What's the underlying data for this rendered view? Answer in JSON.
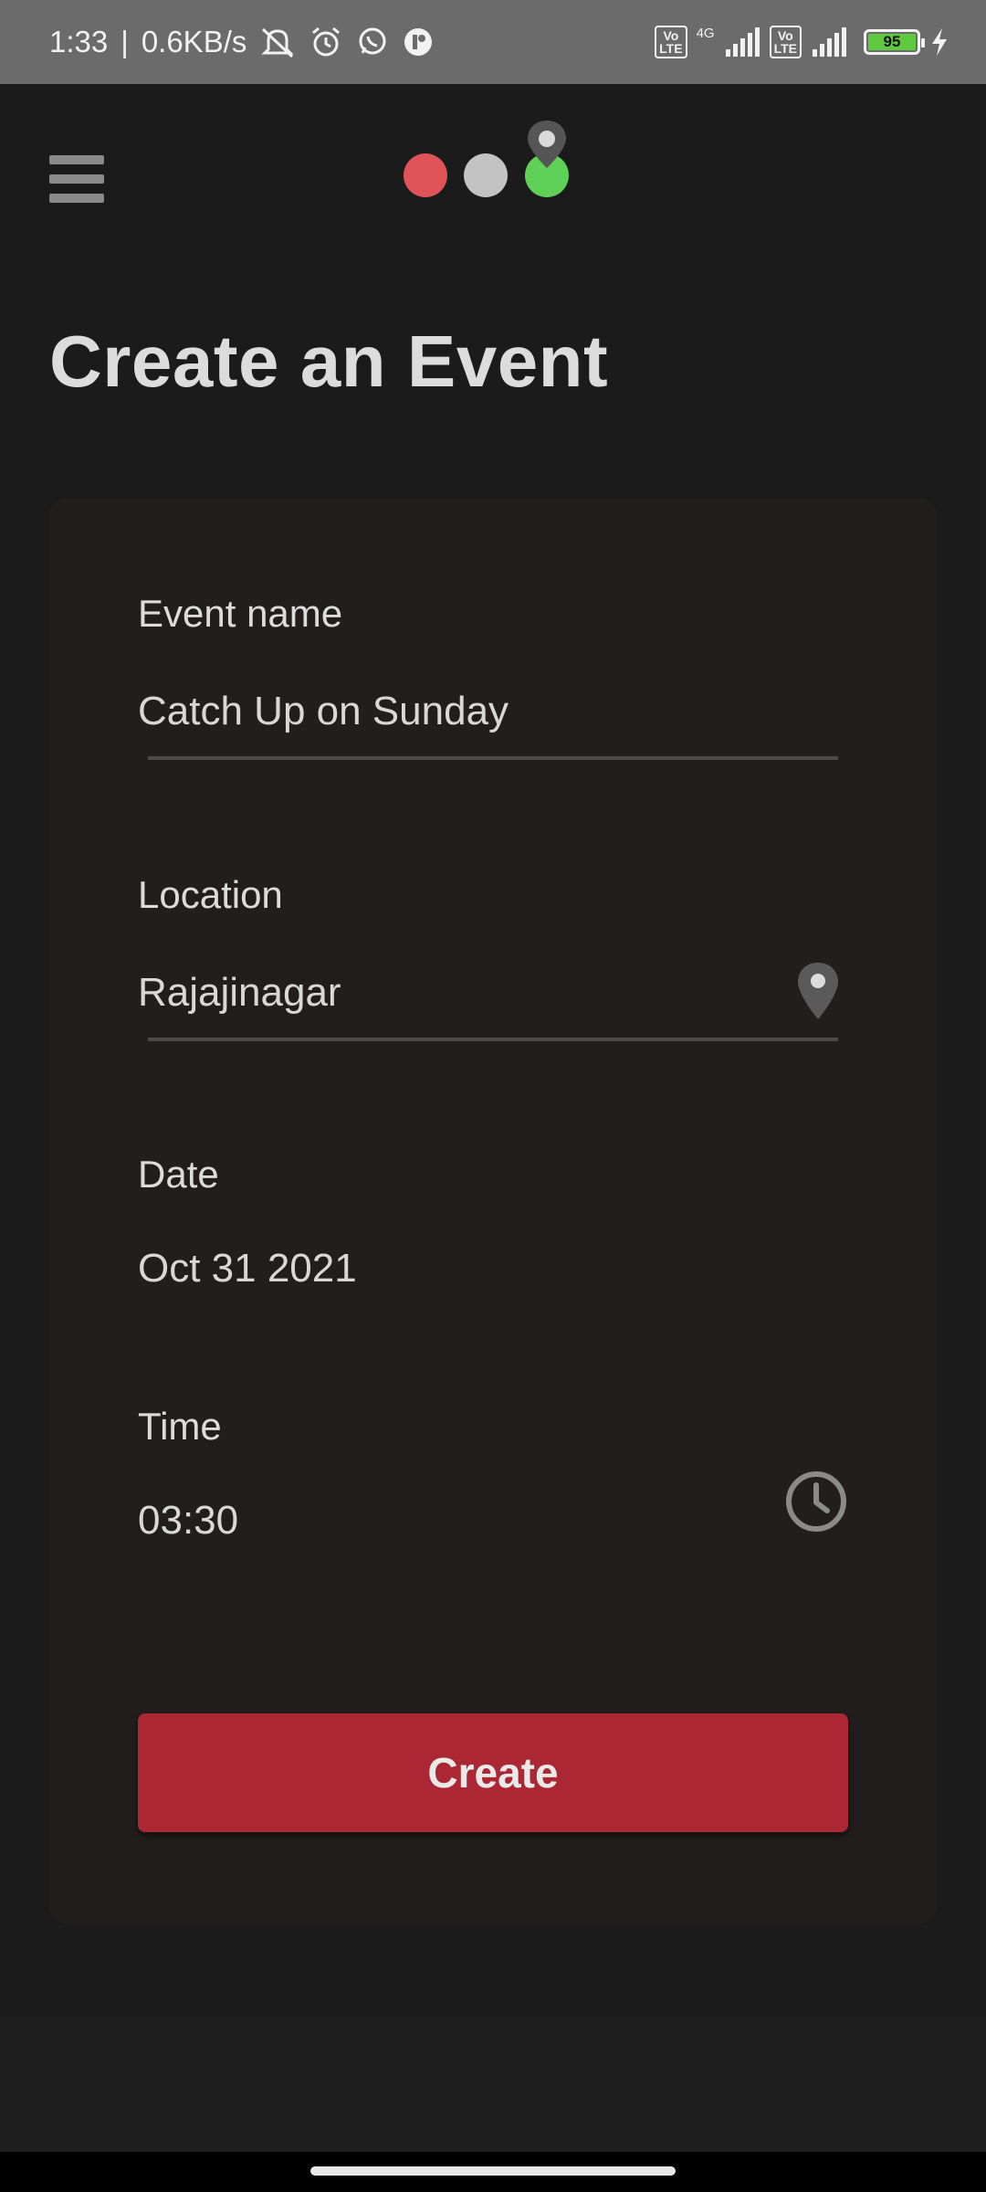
{
  "status_bar": {
    "time": "1:33",
    "speed": "0.6KB/s",
    "network": "4G",
    "volte": "Vo\nLTE",
    "battery": "95",
    "icons": [
      "mute-icon",
      "alarm-icon",
      "whatsapp-icon",
      "app-notification-icon",
      "signal-icon",
      "charging-icon"
    ]
  },
  "app_bar": {
    "menu_icon": "hamburger-menu-icon",
    "logo": {
      "colors": [
        "#e05459",
        "#c3c3c3",
        "#5ed156"
      ],
      "pin_color": "#7a7a7a"
    }
  },
  "page": {
    "title": "Create an Event"
  },
  "form": {
    "event_name": {
      "label": "Event name",
      "value": "Catch Up on Sunday"
    },
    "location": {
      "label": "Location",
      "value": "Rajajinagar",
      "icon": "location-pin-icon"
    },
    "date": {
      "label": "Date",
      "value": "Oct 31 2021"
    },
    "time": {
      "label": "Time",
      "value": "03:30",
      "icon": "clock-icon"
    },
    "submit_label": "Create"
  },
  "colors": {
    "accent": "#ab2733",
    "card": "#231e1e",
    "background": "#1b1b1c"
  }
}
